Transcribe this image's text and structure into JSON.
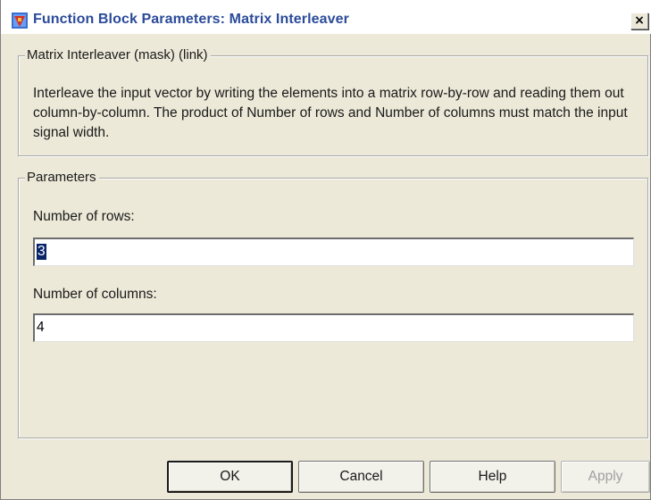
{
  "window": {
    "title": "Function Block Parameters: Matrix Interleaver",
    "close_symbol": "×"
  },
  "mask_group": {
    "legend": "Matrix Interleaver (mask) (link)",
    "description": "Interleave the input vector by writing the elements into a matrix row-by-row and reading them out column-by-column.  The product of Number of rows and Number of columns must match the input signal width."
  },
  "parameters_group": {
    "legend": "Parameters",
    "rows_label": "Number of rows:",
    "rows_value": "3",
    "columns_label": "Number of columns:",
    "columns_value": "4"
  },
  "buttons": {
    "ok": "OK",
    "cancel": "Cancel",
    "help": "Help",
    "apply": "Apply"
  },
  "icons": {
    "title_icon": "simulink-block-icon",
    "close_icon": "close-icon"
  },
  "colors": {
    "dialog_bg": "#ece9d8",
    "title_text": "#2b4b9a",
    "selection_bg": "#0a246a"
  }
}
